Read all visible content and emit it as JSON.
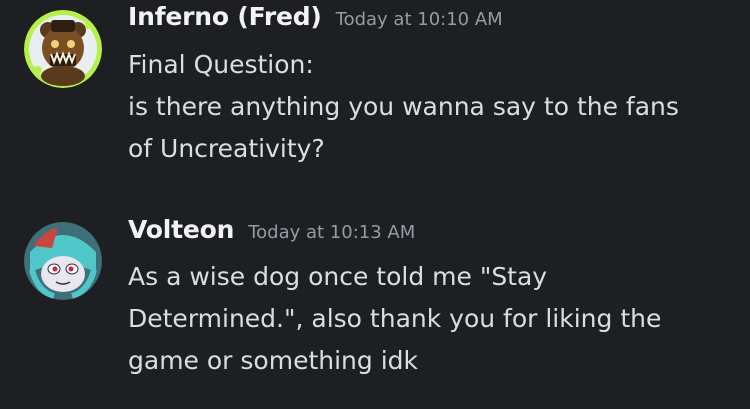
{
  "colors": {
    "background": "#1e1f22",
    "username": "#f2f3f5",
    "timestamp": "#949ba4",
    "text": "#dbdee1",
    "fred_ring": "#b7f04a",
    "volteon_hair": "#4fc7c9"
  },
  "messages": [
    {
      "author": "Inferno (Fred)",
      "timestamp": "Today at 10:10 AM",
      "avatar_icon": "fredbear-avatar-icon",
      "lines": [
        "Final Question:",
        "is there anything you wanna say to the fans",
        "of Uncreativity?"
      ]
    },
    {
      "author": "Volteon",
      "timestamp": "Today at 10:13 AM",
      "avatar_icon": "volteon-avatar-icon",
      "lines": [
        "As a wise dog once told me \"Stay",
        "Determined.\", also thank you for liking the",
        "game or something idk"
      ]
    }
  ]
}
